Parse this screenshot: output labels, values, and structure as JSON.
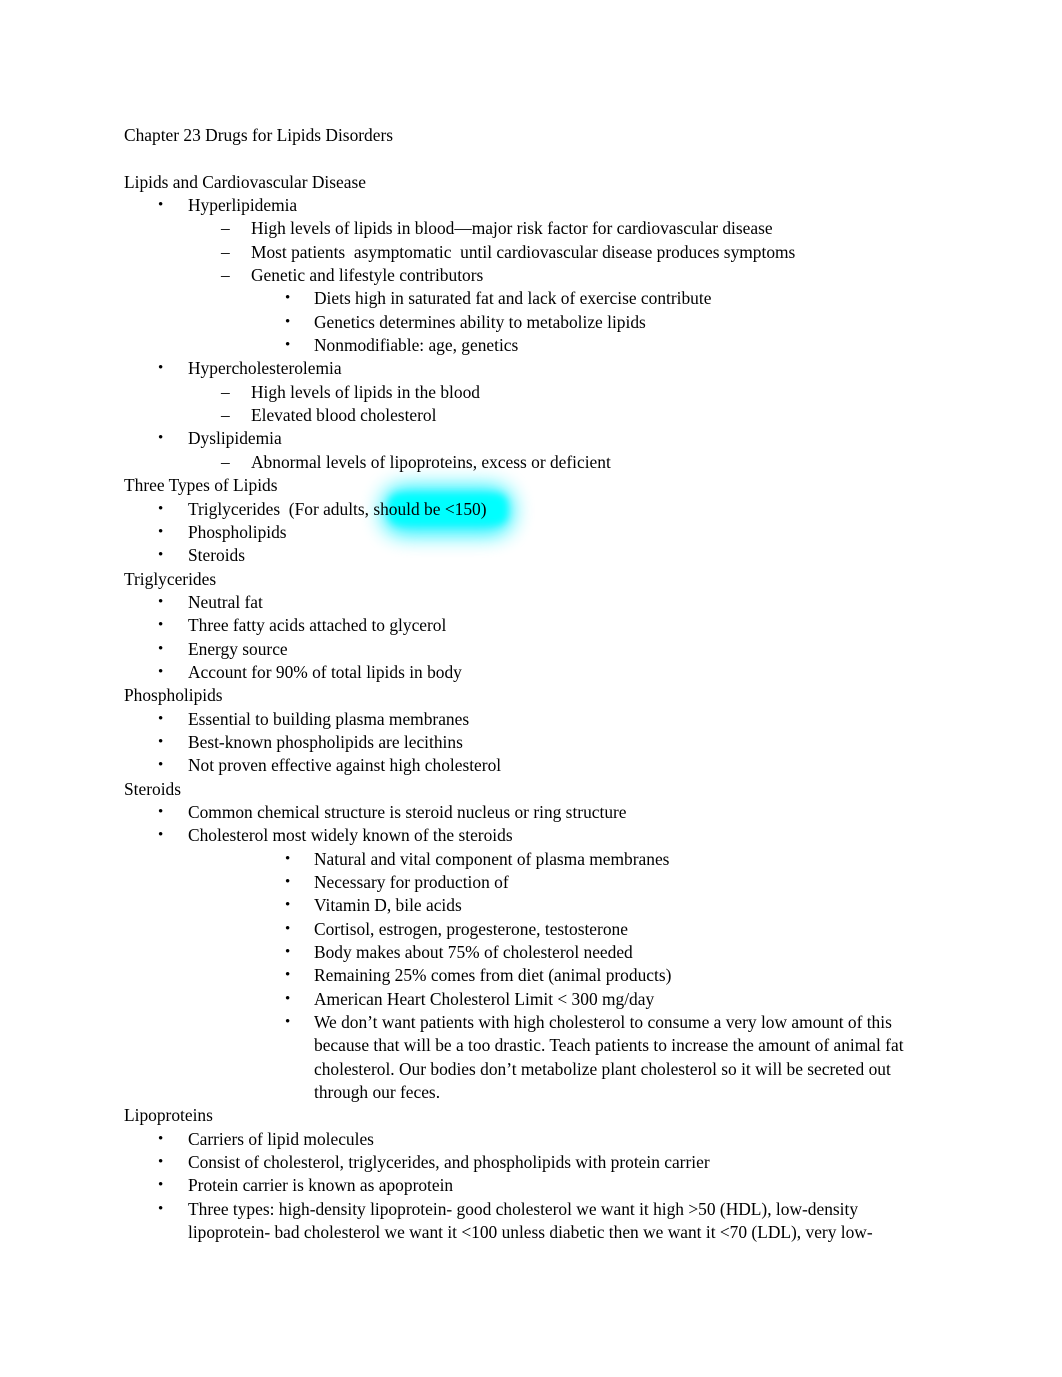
{
  "document": {
    "title": "Chapter 23 Drugs for Lipids Disorders",
    "highlight_color": "#00FFFF",
    "text_color": "#000000",
    "background_color": "#FFFFFF",
    "bullet_glyphs": {
      "dot": "•",
      "dash": "–"
    },
    "blocks": [
      {
        "id": "title",
        "level": 0,
        "marker": "",
        "text": "Chapter 23 Drugs for Lipids Disorders"
      },
      {
        "id": "spacer-1",
        "level": 0,
        "marker": "",
        "text": ""
      },
      {
        "id": "h-lipids-cvd",
        "level": 0,
        "marker": "",
        "text": "Lipids and Cardiovascular Disease"
      },
      {
        "id": "hyperlipidemia",
        "level": 1,
        "marker": "•",
        "text": "Hyperlipidemia"
      },
      {
        "id": "hyperlipidemia-1",
        "level": 2,
        "marker": "–",
        "text": "High levels of lipids in blood—major risk factor for cardiovascular disease"
      },
      {
        "id": "hyperlipidemia-2",
        "level": 2,
        "marker": "–",
        "text": "Most patients  asymptomatic  until cardiovascular disease produces symptoms"
      },
      {
        "id": "hyperlipidemia-3",
        "level": 2,
        "marker": "–",
        "text": "Genetic and lifestyle contributors"
      },
      {
        "id": "hyperlipidemia-3a",
        "level": 3,
        "marker": "•",
        "text": "Diets high in saturated fat and lack of exercise contribute"
      },
      {
        "id": "hyperlipidemia-3b",
        "level": 3,
        "marker": "•",
        "text": "Genetics determines ability to metabolize lipids"
      },
      {
        "id": "hyperlipidemia-3c",
        "level": 3,
        "marker": "•",
        "text": "Nonmodifiable: age, genetics"
      },
      {
        "id": "hypercholesterolemia",
        "level": 1,
        "marker": "•",
        "text": "Hypercholesterolemia"
      },
      {
        "id": "hypercholesterolemia-1",
        "level": 2,
        "marker": "–",
        "text": "High levels of lipids in the blood"
      },
      {
        "id": "hypercholesterolemia-2",
        "level": 2,
        "marker": "–",
        "text": "Elevated blood cholesterol"
      },
      {
        "id": "dyslipidemia",
        "level": 1,
        "marker": "•",
        "text": "Dyslipidemia"
      },
      {
        "id": "dyslipidemia-1",
        "level": 2,
        "marker": "–",
        "text": "Abnormal levels of lipoproteins, excess or deficient"
      },
      {
        "id": "h-three-types",
        "level": 0,
        "marker": "",
        "text": "Three Types of Lipids"
      },
      {
        "id": "three-types-1",
        "level": 1,
        "marker": "•",
        "text": "Triglycerides  (For adults, should be <150)",
        "highlighted": true,
        "plain_prefix": "Triglycerides  (For adults, ",
        "highlighted_text": "should be <150)"
      },
      {
        "id": "three-types-2",
        "level": 1,
        "marker": "•",
        "text": "Phospholipids"
      },
      {
        "id": "three-types-3",
        "level": 1,
        "marker": "•",
        "text": "Steroids"
      },
      {
        "id": "h-triglycerides",
        "level": 0,
        "marker": "",
        "text": "Triglycerides"
      },
      {
        "id": "triglycerides-1",
        "level": 1,
        "marker": "•",
        "text": "Neutral fat"
      },
      {
        "id": "triglycerides-2",
        "level": 1,
        "marker": "•",
        "text": "Three fatty acids attached to glycerol"
      },
      {
        "id": "triglycerides-3",
        "level": 1,
        "marker": "•",
        "text": "Energy source"
      },
      {
        "id": "triglycerides-4",
        "level": 1,
        "marker": "•",
        "text": "Account for 90% of total lipids in body"
      },
      {
        "id": "h-phospholipids",
        "level": 0,
        "marker": "",
        "text": "Phospholipids"
      },
      {
        "id": "phospholipids-1",
        "level": 1,
        "marker": "•",
        "text": "Essential to building plasma membranes"
      },
      {
        "id": "phospholipids-2",
        "level": 1,
        "marker": "•",
        "text": "Best-known phospholipids are lecithins"
      },
      {
        "id": "phospholipids-3",
        "level": 1,
        "marker": "•",
        "text": "Not proven effective against high cholesterol"
      },
      {
        "id": "h-steroids",
        "level": 0,
        "marker": "",
        "text": "Steroids"
      },
      {
        "id": "steroids-1",
        "level": 1,
        "marker": "•",
        "text": "Common chemical structure is steroid nucleus or ring structure"
      },
      {
        "id": "steroids-2",
        "level": 1,
        "marker": "•",
        "text": "Cholesterol most widely known of the steroids"
      },
      {
        "id": "steroids-2a",
        "level": 3,
        "marker": "•",
        "text": "Natural and vital component of plasma membranes"
      },
      {
        "id": "steroids-2b",
        "level": 3,
        "marker": "•",
        "text": "Necessary for production of"
      },
      {
        "id": "steroids-2b-i",
        "level": 4,
        "marker": "•",
        "text": "Vitamin D, bile acids"
      },
      {
        "id": "steroids-2b-ii",
        "level": 4,
        "marker": "•",
        "text": "Cortisol, estrogen, progesterone, testosterone"
      },
      {
        "id": "steroids-2c",
        "level": 3,
        "marker": "•",
        "text": "Body makes about 75% of cholesterol needed"
      },
      {
        "id": "steroids-2d",
        "level": 3,
        "marker": "•",
        "text": "Remaining 25% comes from diet (animal products)"
      },
      {
        "id": "steroids-2d-i",
        "level": 4,
        "marker": "•",
        "text": "American Heart Cholesterol Limit < 300 mg/day"
      },
      {
        "id": "steroids-2d-ii",
        "level": 4,
        "marker": "•",
        "text": "We don’t want patients with high cholesterol to consume a very low amount of this because that will be a too drastic. Teach patients to increase the amount of animal fat cholesterol. Our bodies don’t metabolize plant cholesterol so it will be secreted out through our feces."
      },
      {
        "id": "h-lipoproteins",
        "level": 0,
        "marker": "",
        "text": "Lipoproteins"
      },
      {
        "id": "lipoproteins-1",
        "level": 1,
        "marker": "•",
        "text": "Carriers of lipid molecules"
      },
      {
        "id": "lipoproteins-2",
        "level": 1,
        "marker": "•",
        "text": "Consist of cholesterol, triglycerides, and phospholipids with protein carrier"
      },
      {
        "id": "lipoproteins-3",
        "level": 1,
        "marker": "•",
        "text": "Protein carrier is known as apoprotein"
      },
      {
        "id": "lipoproteins-4",
        "level": 1,
        "marker": "•",
        "text": "Three types: high-density lipoprotein- good cholesterol we want it high >50 (HDL), low-density lipoprotein- bad cholesterol we want it <100 unless diabetic then we want it <70 (LDL), very low-"
      }
    ]
  }
}
